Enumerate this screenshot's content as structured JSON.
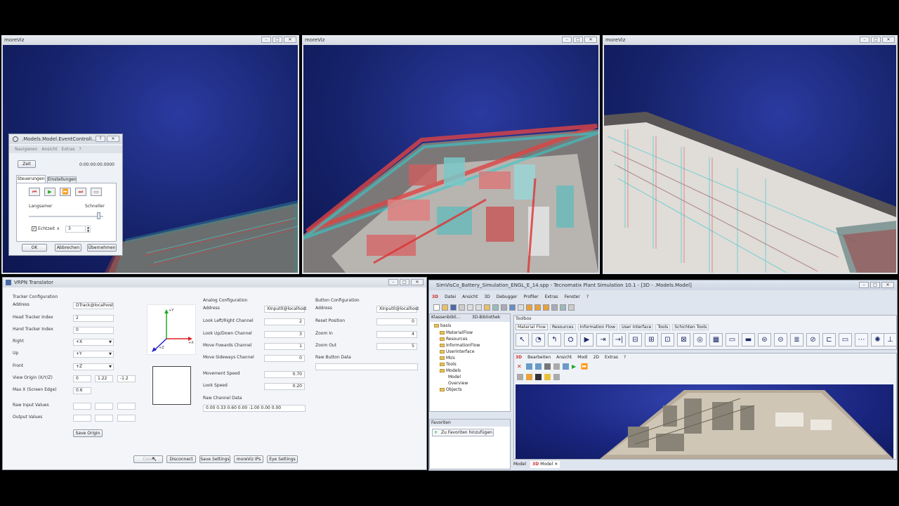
{
  "viewers": [
    {
      "title": "moreViz"
    },
    {
      "title": "moreViz"
    },
    {
      "title": "moreViz"
    }
  ],
  "event_controller": {
    "title": ".Models.Model.EventControll...",
    "menu": [
      "Navigieren",
      "Ansicht",
      "Extras",
      "?"
    ],
    "zeit_button": "Zeit",
    "time": "0:00:00:00.0000",
    "tabs": [
      "Steuerungen",
      "Einstellungen"
    ],
    "slow_label": "Langsamer",
    "fast_label": "Schneller",
    "realtime_label": "Echtzeit",
    "realtime_x": "x",
    "realtime_value": "3",
    "ok": "OK",
    "cancel": "Abbrechen",
    "apply": "Übernehmen"
  },
  "vrpn": {
    "title": "VRPN Translator",
    "tracker": {
      "heading": "Tracker Configuration",
      "address_label": "Address",
      "address": "DTrack@localhost",
      "head_label": "Head Tracker Index",
      "head": "2",
      "hand_label": "Hand Tracker Index",
      "hand": "0",
      "right_label": "Right",
      "right": "+X",
      "up_label": "Up",
      "up": "+Y",
      "front_label": "Front",
      "front": "+Z",
      "origin_label": "View Origin (X/Y/Z)",
      "origin": [
        "0",
        "1.22",
        "-1.2"
      ],
      "maxx_label": "Max X (Screen Edge)",
      "maxx": "0.6",
      "raw_label": "Raw Input Values",
      "output_label": "Output Values",
      "save_origin": "Save Origin"
    },
    "axes": {
      "y": "+Y",
      "x": "+X",
      "z": "+Z"
    },
    "analog": {
      "heading": "Analog Configuration",
      "address_label": "Address",
      "address": "XInput0@localhost",
      "rows": [
        {
          "label": "Look Left/Right Channel",
          "value": "2"
        },
        {
          "label": "Look Up/Down Channel",
          "value": "3"
        },
        {
          "label": "Move Fowards Channel",
          "value": "1"
        },
        {
          "label": "Move Sideways Channel",
          "value": "0"
        }
      ],
      "movement_label": "Movement Speed",
      "movement": "0.70",
      "look_label": "Look Speed",
      "look": "0.20",
      "raw_label": "Raw Channel Data",
      "raw": "0.00 0.33 0.60 0.00 -1.00 0.00 0.00"
    },
    "button": {
      "heading": "Button Configuration",
      "address_label": "Address",
      "address": "XInput0@localhost",
      "rows": [
        {
          "label": "Reset Position",
          "value": "0"
        },
        {
          "label": "Zoom In",
          "value": "4"
        },
        {
          "label": "Zoom Out",
          "value": "5"
        }
      ],
      "raw_label": "Raw Button Data"
    },
    "actions": [
      "Conn",
      "Disconnect",
      "Save Settings",
      "moreViz IPs",
      "Eye Settings"
    ]
  },
  "plant": {
    "title": "SimVisCo_Battery_Simulation_ENGL_E_14.spp - Tecnomatix Plant Simulation 10.1 - [3D - .Models.Model]",
    "menu": [
      "Datei",
      "Ansicht",
      "3D",
      "Debugger",
      "Profiler",
      "Extras",
      "Fenster",
      "?"
    ],
    "lib_tabs": [
      "Klassenbibli...",
      "3D-Bibliothek"
    ],
    "tree": [
      "basis",
      "MaterialFlow",
      "Resources",
      "InformationFlow",
      "UserInterface",
      "MUs",
      "Tools",
      "Models",
      "Model",
      "Overview",
      "Objects"
    ],
    "favorites_title": "Favoriten",
    "favorites_add": "Zu Favoriten hinzufügen",
    "toolbox_title": "Toolbox",
    "toolbox_tabs": [
      "Material Flow",
      "Resources",
      "Information Flow",
      "User Interface",
      "Tools",
      "Schichten Tools"
    ],
    "view_menu": [
      "Bearbeiten",
      "Ansicht",
      "Modi",
      "2D",
      "Extras",
      "?"
    ],
    "bottom_tabs": [
      "Model",
      "Model"
    ]
  }
}
